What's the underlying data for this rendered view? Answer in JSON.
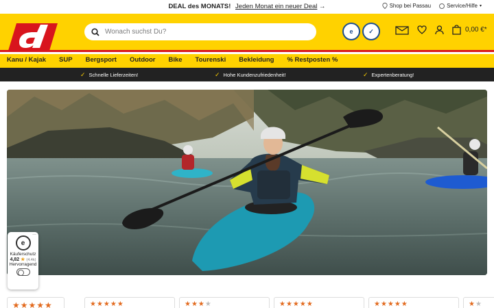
{
  "promo": {
    "deal_label": "DEAL des MONATS!",
    "deal_link": "Jeden Monat ein neuer Deal",
    "arrow": "→",
    "shop_link": "Shop bei Passau",
    "service_link": "Service/Hilfe"
  },
  "header": {
    "search_placeholder": "Wonach suchst Du?",
    "cart_total": "0,00 €*",
    "cart_star": "*",
    "badge1": "e",
    "badge2": "✓"
  },
  "nav": [
    "Kanu / Kajak",
    "SUP",
    "Bergsport",
    "Outdoor",
    "Bike",
    "Tourenski",
    "Bekleidung",
    "% Restposten %"
  ],
  "usp": [
    "Schnelle Lieferzeiten!",
    "Hohe Kundenzufriedenheit!",
    "Expertenberatung!"
  ],
  "trust": {
    "seal": "e",
    "label": "Käuferschutz",
    "score": "4,82",
    "count": "(4.4k)",
    "verdict": "Hervorragend",
    "menu": "..."
  },
  "reviews": [
    {
      "stars": 5
    },
    {
      "stars": 5
    },
    {
      "stars": 3
    },
    {
      "stars": 4
    },
    {
      "stars": 5
    },
    {
      "stars": 1
    }
  ],
  "colors": {
    "brand_yellow": "#ffd200",
    "brand_red": "#d8151d",
    "dark_bar": "#222222",
    "star": "#e26a1e"
  }
}
